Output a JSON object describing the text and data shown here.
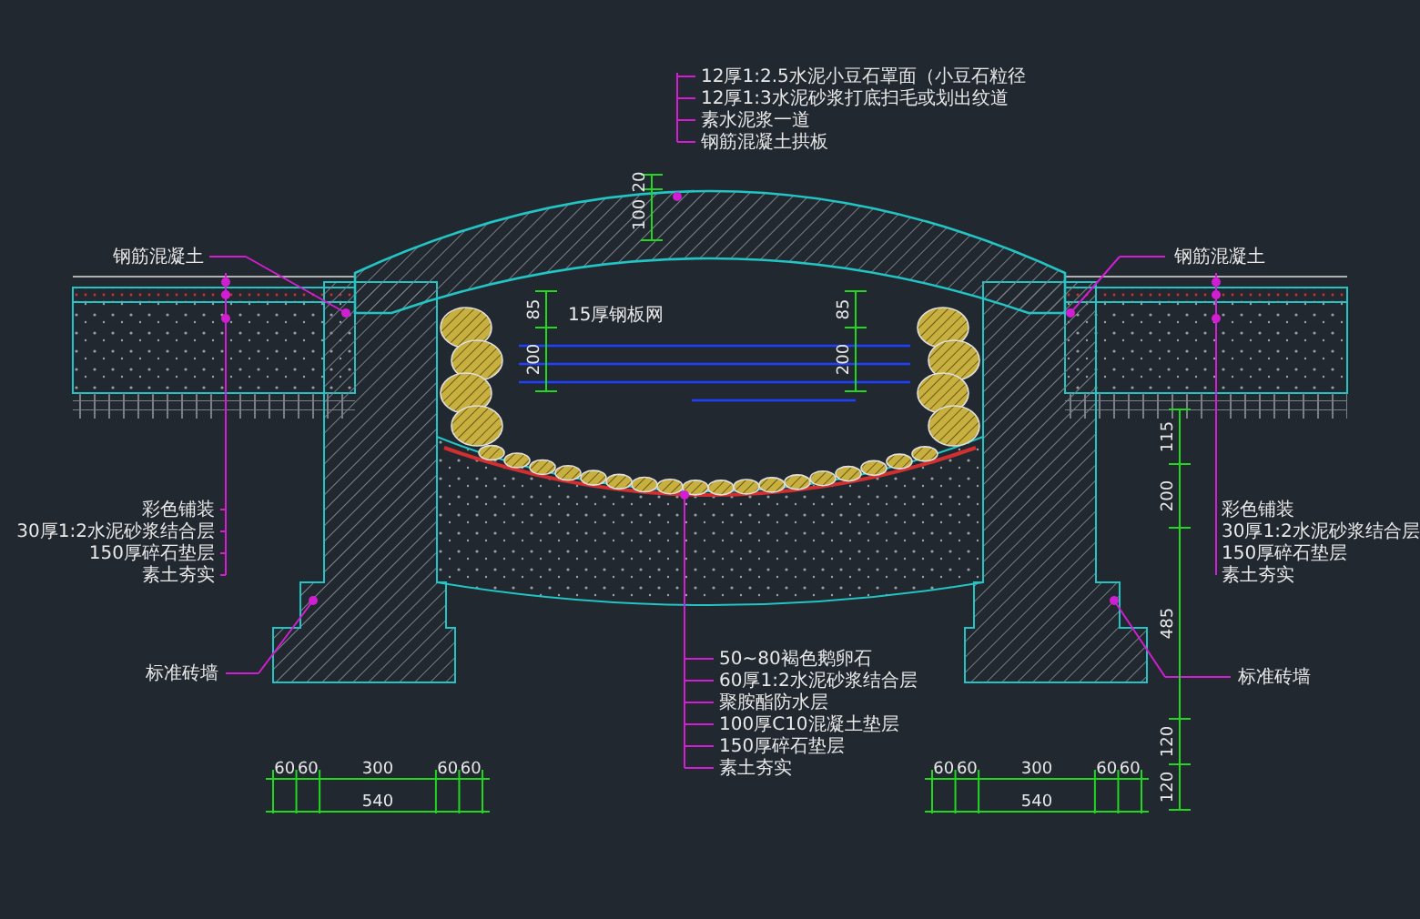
{
  "drawing": {
    "top_notes": [
      "12厚1:2.5水泥小豆石罩面（小豆石粒径",
      "12厚1:3水泥砂浆打底扫毛或划出纹道",
      "素水泥浆一道",
      "钢筋混凝土拱板"
    ],
    "left_note": "钢筋混凝土",
    "right_note": "钢筋混凝土",
    "water_note": "15厚钢板网",
    "left_layers": [
      "彩色铺装",
      "30厚1:2水泥砂浆结合层",
      "150厚碎石垫层",
      "素土夯实"
    ],
    "right_layers": [
      "彩色铺装",
      "30厚1:2水泥砂浆结合层",
      "150厚碎石垫层",
      "素土夯实"
    ],
    "center_layers": [
      "50~80褐色鹅卵石",
      "60厚1:2水泥砂浆结合层",
      "聚胺酯防水层",
      "100厚C10混凝土垫层",
      "150厚碎石垫层",
      "素土夯实"
    ],
    "left_wall_note": "标准砖墙",
    "right_wall_note": "标准砖墙",
    "arch_dims": [
      "20",
      "100"
    ],
    "left_inner_dims": [
      "85",
      "200"
    ],
    "right_inner_dims": [
      "85",
      "200"
    ],
    "side_dims": [
      "115",
      "200",
      "485",
      "120",
      "120"
    ],
    "left_base_dims": [
      "60",
      "60",
      "300",
      "60",
      "60",
      "540"
    ],
    "right_base_dims": [
      "60",
      "60",
      "300",
      "60",
      "60",
      "540"
    ]
  }
}
